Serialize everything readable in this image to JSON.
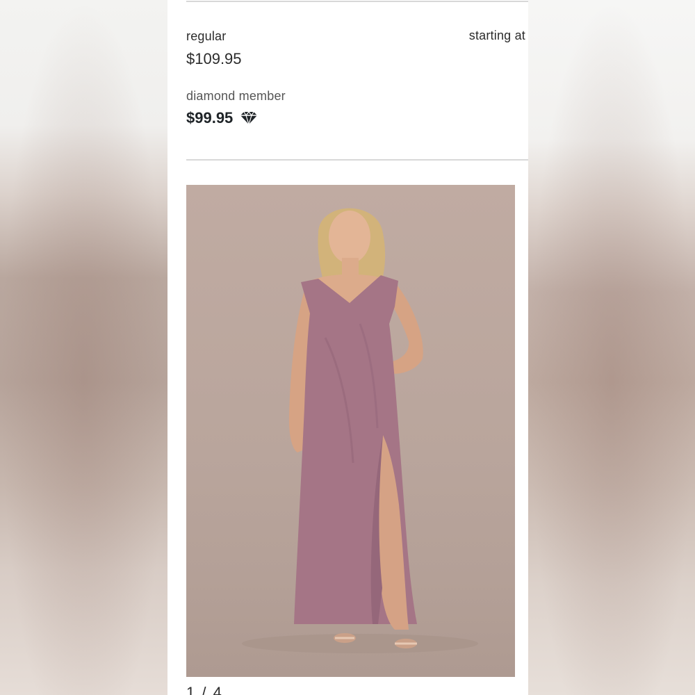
{
  "pricing": {
    "regular_label": "regular",
    "regular_price": "$109.95",
    "starting_label": "starting at",
    "member_label": "diamond member",
    "member_price": "$99.95"
  },
  "gallery": {
    "pager": "1 / 4",
    "dress_color": "#a57586",
    "background_color": "#bba79e"
  },
  "icons": {
    "member_badge": "diamond-icon"
  }
}
